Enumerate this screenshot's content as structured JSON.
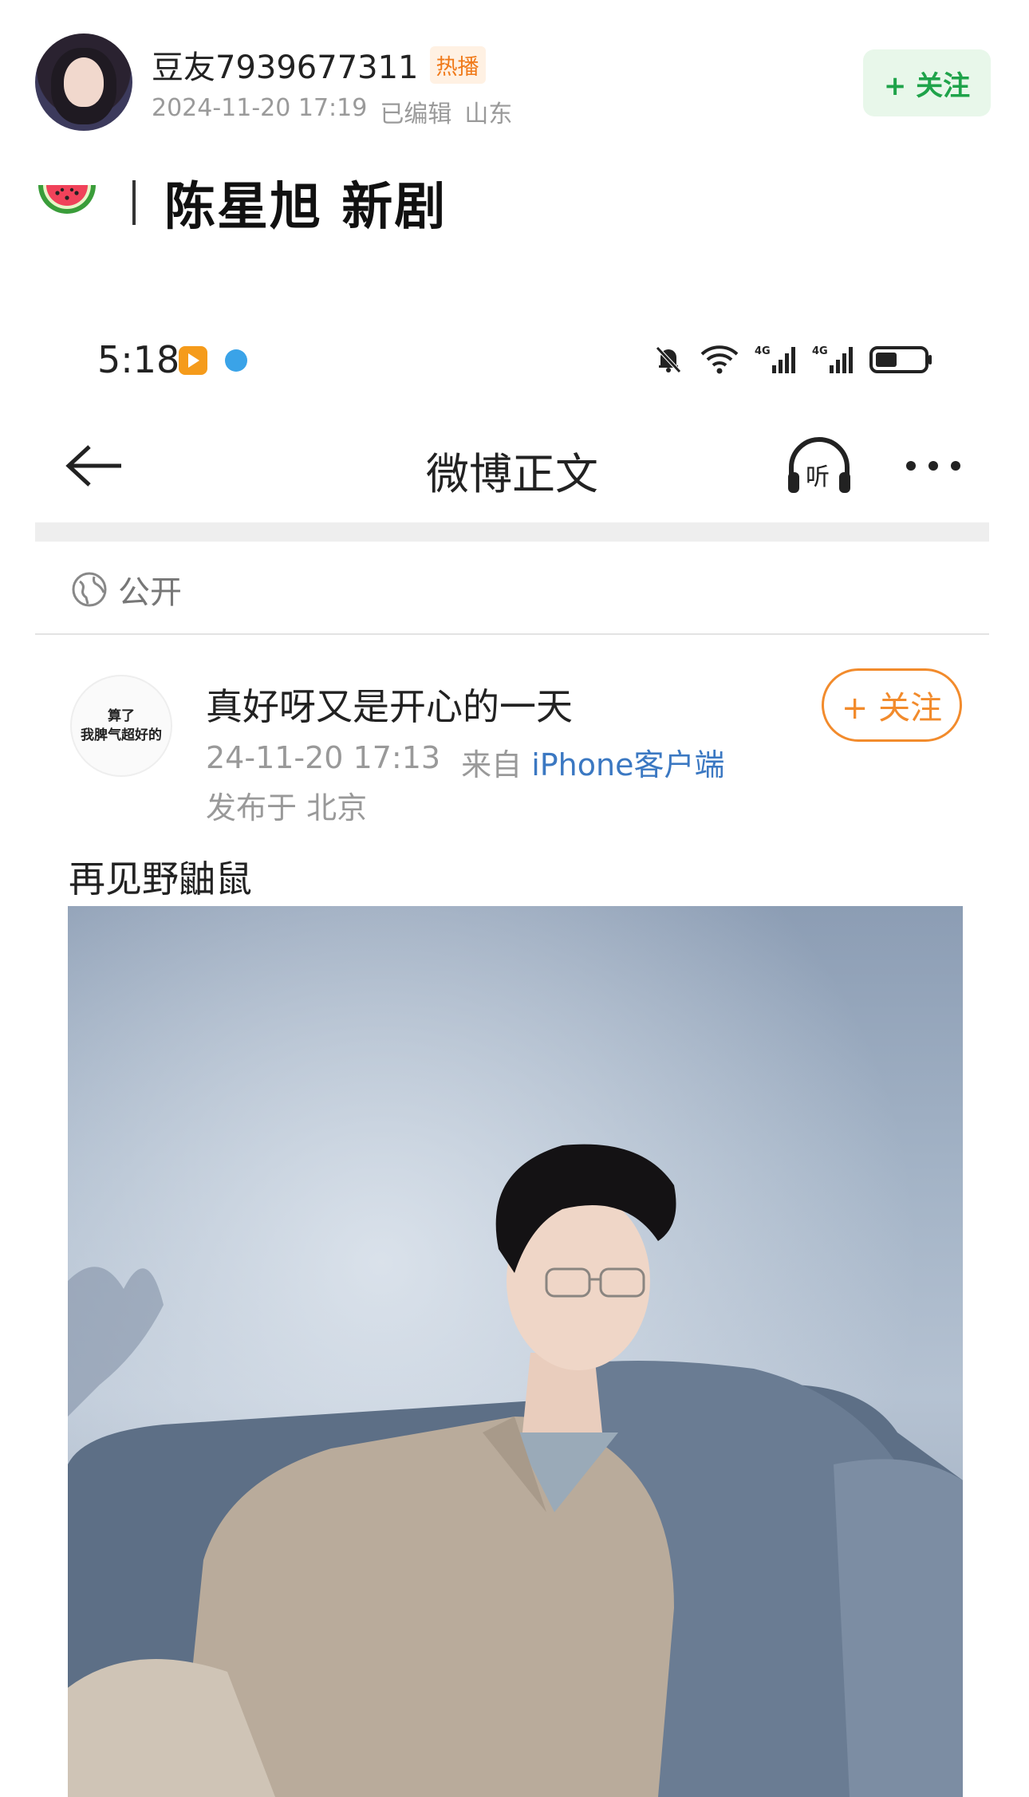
{
  "outer_post": {
    "username": "豆友7939677311",
    "badge": "热播",
    "datetime": "2024-11-20 17:19",
    "edited": "已编辑",
    "location": "山东",
    "follow_label": "+ 关注",
    "title": "陈星旭 新剧"
  },
  "status_bar": {
    "time": "5:18"
  },
  "nav": {
    "title": "微博正文"
  },
  "visibility": "公开",
  "weibo": {
    "avatar_line1": "算了",
    "avatar_line2": "我脾气超好的",
    "username": "真好呀又是开心的一天",
    "datetime": "24-11-20 17:13",
    "source_prefix": "来自",
    "source": "iPhone客户端",
    "location": "发布于 北京",
    "follow_label": "+ 关注",
    "text": "再见野鼬鼠"
  },
  "colors": {
    "follow_green": "#1fa34a",
    "follow_orange": "#f28b2c",
    "hot_badge": "#f07a1a",
    "link_blue": "#3b78c2"
  }
}
